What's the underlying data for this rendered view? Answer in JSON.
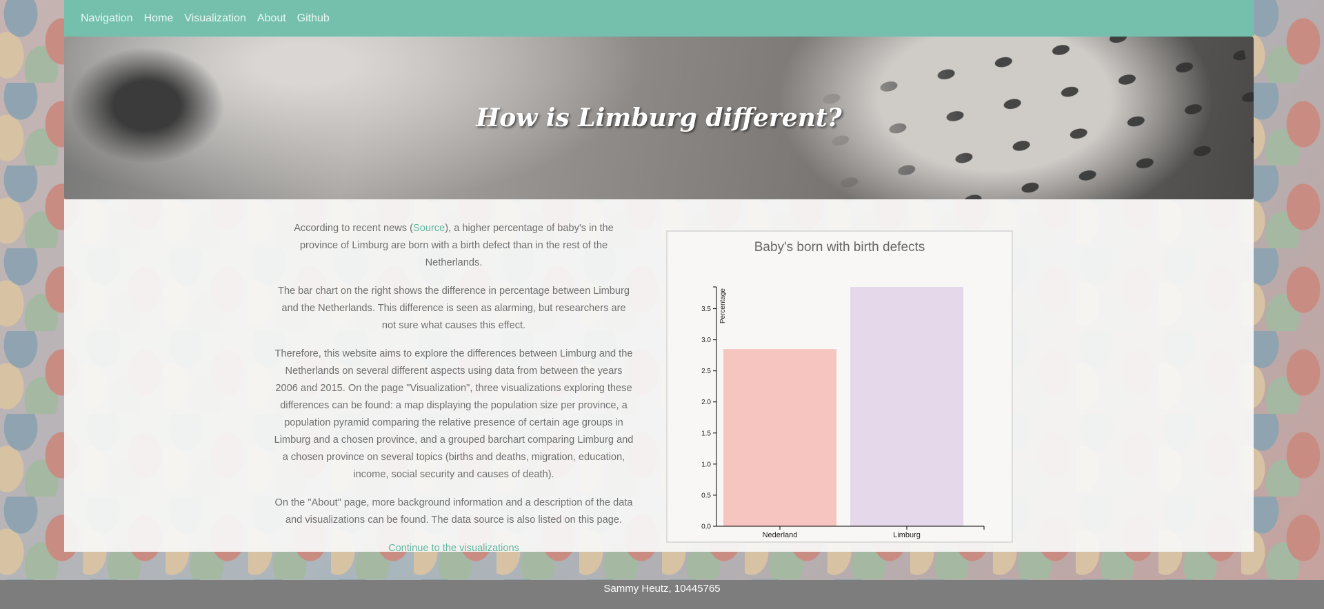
{
  "nav": {
    "items": [
      "Navigation",
      "Home",
      "Visualization",
      "About",
      "Github"
    ]
  },
  "hero": {
    "title": "How is Limburg different?"
  },
  "intro": {
    "p1_before": "According to recent news (",
    "p1_link": "Source",
    "p1_after": "), a higher percentage of baby's in the province of Limburg are born with a birth defect than in the rest of the Netherlands.",
    "p2": "The bar chart on the right shows the difference in percentage between Limburg and the Netherlands. This difference is seen as alarming, but researchers are not sure what causes this effect.",
    "p3": "Therefore, this website aims to explore the differences between Limburg and the Netherlands on several different aspects using data from between the years 2006 and 2015. On the page \"Visualization\", three visualizations exploring these differences can be found: a map displaying the population size per province, a population pyramid comparing the relative presence of certain age groups in Limburg and a chosen province, and a grouped barchart comparing Limburg and a chosen province on several topics (births and deaths, migration, education, income, social security and causes of death).",
    "p4": "On the \"About\" page, more background information and a description of the data and visualizations can be found. The data source is also listed on this page.",
    "continue": "Continue to the visualizations"
  },
  "chart_data": {
    "type": "bar",
    "title": "Baby's born with birth defects",
    "xlabel": "",
    "ylabel": "Percentage",
    "categories": [
      "Nederland",
      "Limburg"
    ],
    "values": [
      2.85,
      3.85
    ],
    "colors": [
      "#f7c5bf",
      "#e5d8ea"
    ],
    "ylim": [
      0,
      3.85
    ],
    "yticks": [
      "0.0",
      "0.5",
      "1.0",
      "1.5",
      "2.0",
      "2.5",
      "3.0",
      "3.5"
    ],
    "grid": false
  },
  "footer": {
    "text": "Sammy Heutz, 10445765"
  }
}
